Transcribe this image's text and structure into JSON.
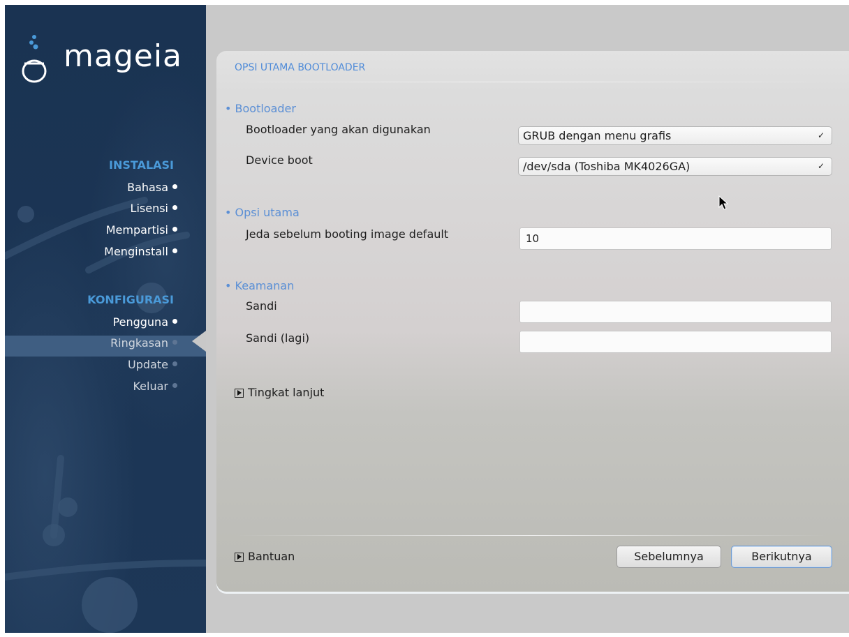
{
  "colors": {
    "sidebar_bg": "#1c3554",
    "section_title": "#4a9ad9",
    "accent": "#4f8bd8"
  },
  "brand": {
    "logo_text": "mageia"
  },
  "sidebar": {
    "sections": [
      {
        "title": "INSTALASI",
        "items": [
          {
            "label": "Bahasa",
            "state": "done"
          },
          {
            "label": "Lisensi",
            "state": "done"
          },
          {
            "label": "Mempartisi",
            "state": "done"
          },
          {
            "label": "Menginstall",
            "state": "done"
          }
        ]
      },
      {
        "title": "KONFIGURASI",
        "items": [
          {
            "label": "Pengguna",
            "state": "done"
          },
          {
            "label": "Ringkasan",
            "state": "active"
          },
          {
            "label": "Update",
            "state": "pending"
          },
          {
            "label": "Keluar",
            "state": "pending"
          }
        ]
      }
    ]
  },
  "page": {
    "title": "OPSI UTAMA BOOTLOADER",
    "groups": {
      "bootloader": {
        "title": "• Bootloader",
        "bootloader_label": "Bootloader yang akan digunakan",
        "bootloader_value": "GRUB dengan menu grafis",
        "device_label": "Device boot",
        "device_value": "/dev/sda (Toshiba MK4026GA)"
      },
      "main_options": {
        "title": "• Opsi utama",
        "delay_label": "Jeda sebelum booting image default",
        "delay_value": "10"
      },
      "security": {
        "title": "• Keamanan",
        "password_label": "Sandi",
        "password_value": "",
        "password_again_label": "Sandi (lagi)",
        "password_again_value": ""
      }
    },
    "advanced_label": "Tingkat lanjut"
  },
  "footer": {
    "help_label": "Bantuan",
    "previous_label": "Sebelumnya",
    "next_label": "Berikutnya"
  }
}
